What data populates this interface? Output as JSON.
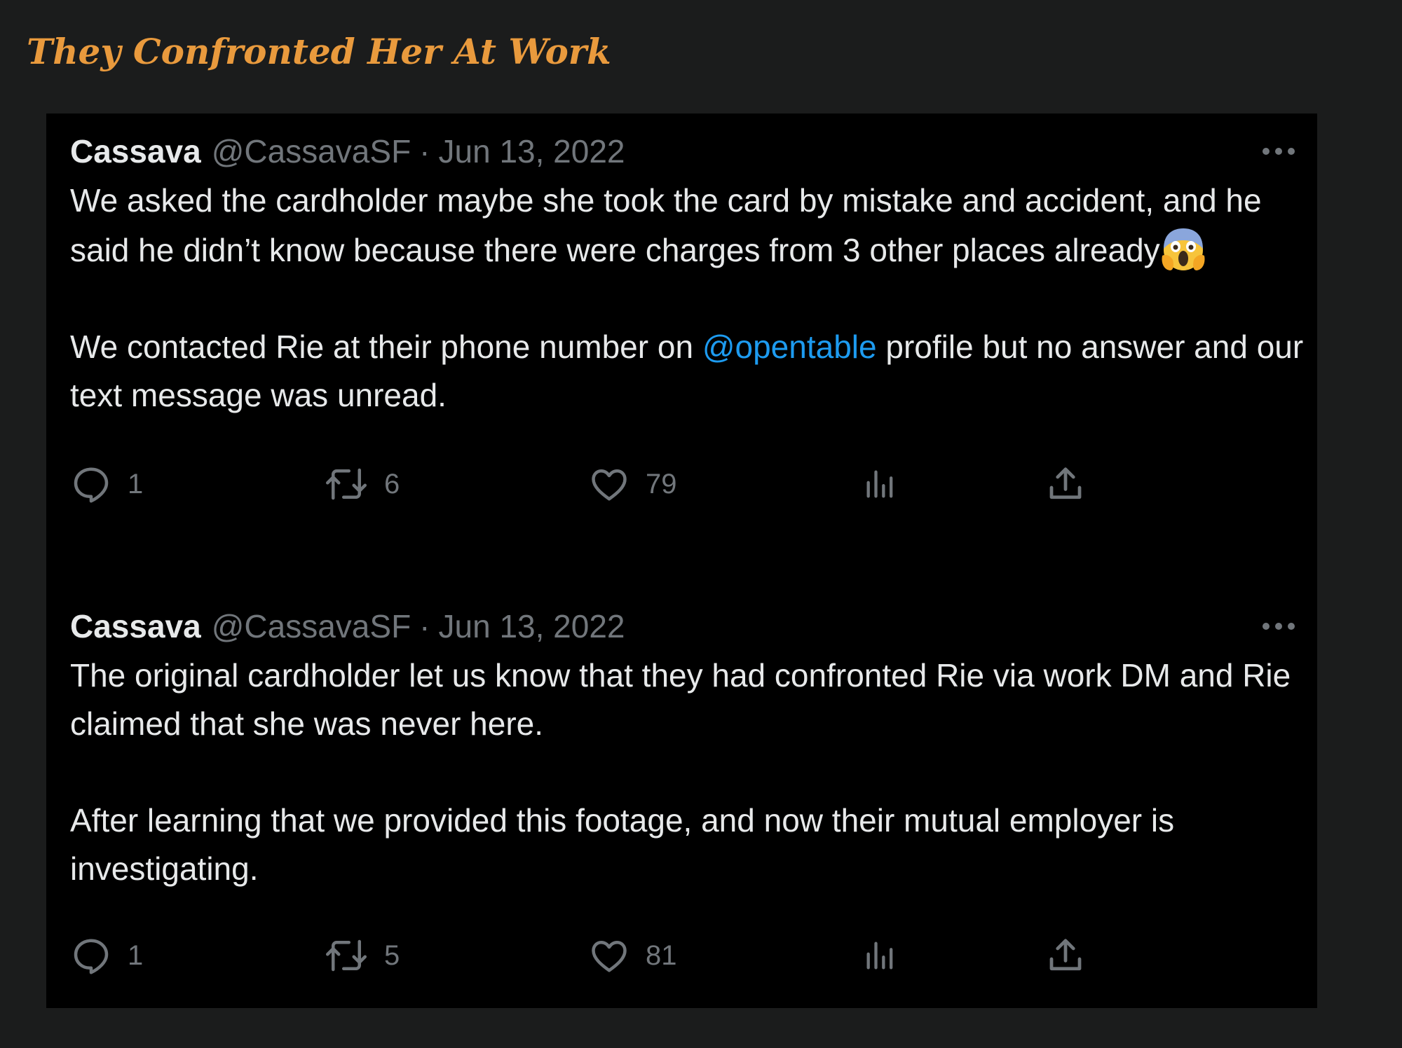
{
  "heading": "They Confronted Her At Work",
  "tweets": [
    {
      "author_name": "Cassava",
      "author_handle": "@CassavaSF",
      "separator": "·",
      "date": "Jun 13, 2022",
      "paragraph_1": "We asked the cardholder maybe she took the card by mistake and accident, and he said he didn’t know because there were charges from 3 other places already",
      "emoji": "😱",
      "paragraph_2_before": "We contacted Rie at their phone number on ",
      "mention": "@opentable",
      "paragraph_2_after": " profile but no answer and our text message was unread.",
      "replies": "1",
      "retweets": "6",
      "likes": "79"
    },
    {
      "author_name": "Cassava",
      "author_handle": "@CassavaSF",
      "separator": "·",
      "date": "Jun 13, 2022",
      "paragraph_1": "The original cardholder let us know that they had confronted Rie via work DM and Rie claimed that she was never here.",
      "paragraph_2": "After learning that we provided this footage, and now their mutual employer is investigating.",
      "replies": "1",
      "retweets": "5",
      "likes": "81"
    }
  ],
  "icons": {
    "reply": "reply-icon",
    "retweet": "retweet-icon",
    "like": "heart-icon",
    "views": "views-icon",
    "share": "share-icon",
    "more": "more-icon"
  },
  "colors": {
    "page_background": "#1b1c1c",
    "heading": "#e99a3d",
    "card_background": "#000000",
    "primary_text": "#e7e9ea",
    "secondary_text": "#71767b",
    "link": "#1d9bf0"
  }
}
